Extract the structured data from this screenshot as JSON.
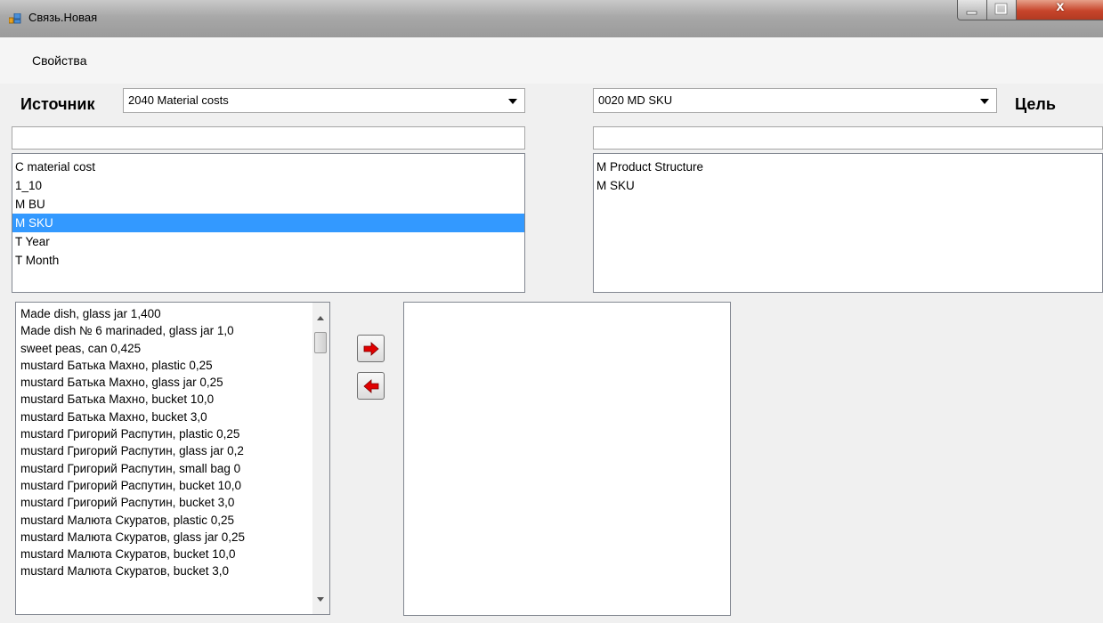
{
  "window": {
    "title": "Связь.Новая",
    "close_glyph": "x"
  },
  "menu": {
    "items": [
      "Свойства"
    ]
  },
  "source": {
    "label": "Источник",
    "combo_value": "2040 Material costs",
    "filter_value": "",
    "dimensions": [
      "C material cost",
      "1_10",
      "M BU",
      "M SKU",
      "T Year",
      "T Month"
    ],
    "selected_dimension": "M SKU"
  },
  "target": {
    "label": "Цель",
    "combo_value": "0020 MD SKU",
    "filter_value": "",
    "dimensions": [
      "M Product Structure",
      "M SKU"
    ]
  },
  "members": [
    "Made dish, glass jar 1,400",
    "Made dish № 6 marinaded, glass jar 1,0",
    "sweet peas, can 0,425",
    "mustard Батька Махно, plastic 0,25",
    "mustard Батька Махно, glass jar 0,25",
    "mustard Батька Махно, bucket 10,0",
    "mustard Батька Махно, bucket 3,0",
    "mustard Григорий Распутин, plastic 0,25",
    "mustard Григорий Распутин, glass jar 0,2",
    "mustard Григорий Распутин, small bag 0",
    "mustard Григорий Распутин, bucket 10,0",
    "mustard Григорий Распутин, bucket 3,0",
    "mustard Малюта Скуратов, plastic 0,25",
    "mustard Малюта Скуратов, glass jar 0,25",
    "mustard Малюта Скуратов, bucket 10,0",
    "mustard Малюта Скуратов, bucket 3,0"
  ],
  "colors": {
    "selection": "#3399ff",
    "arrow": "#e00000"
  }
}
